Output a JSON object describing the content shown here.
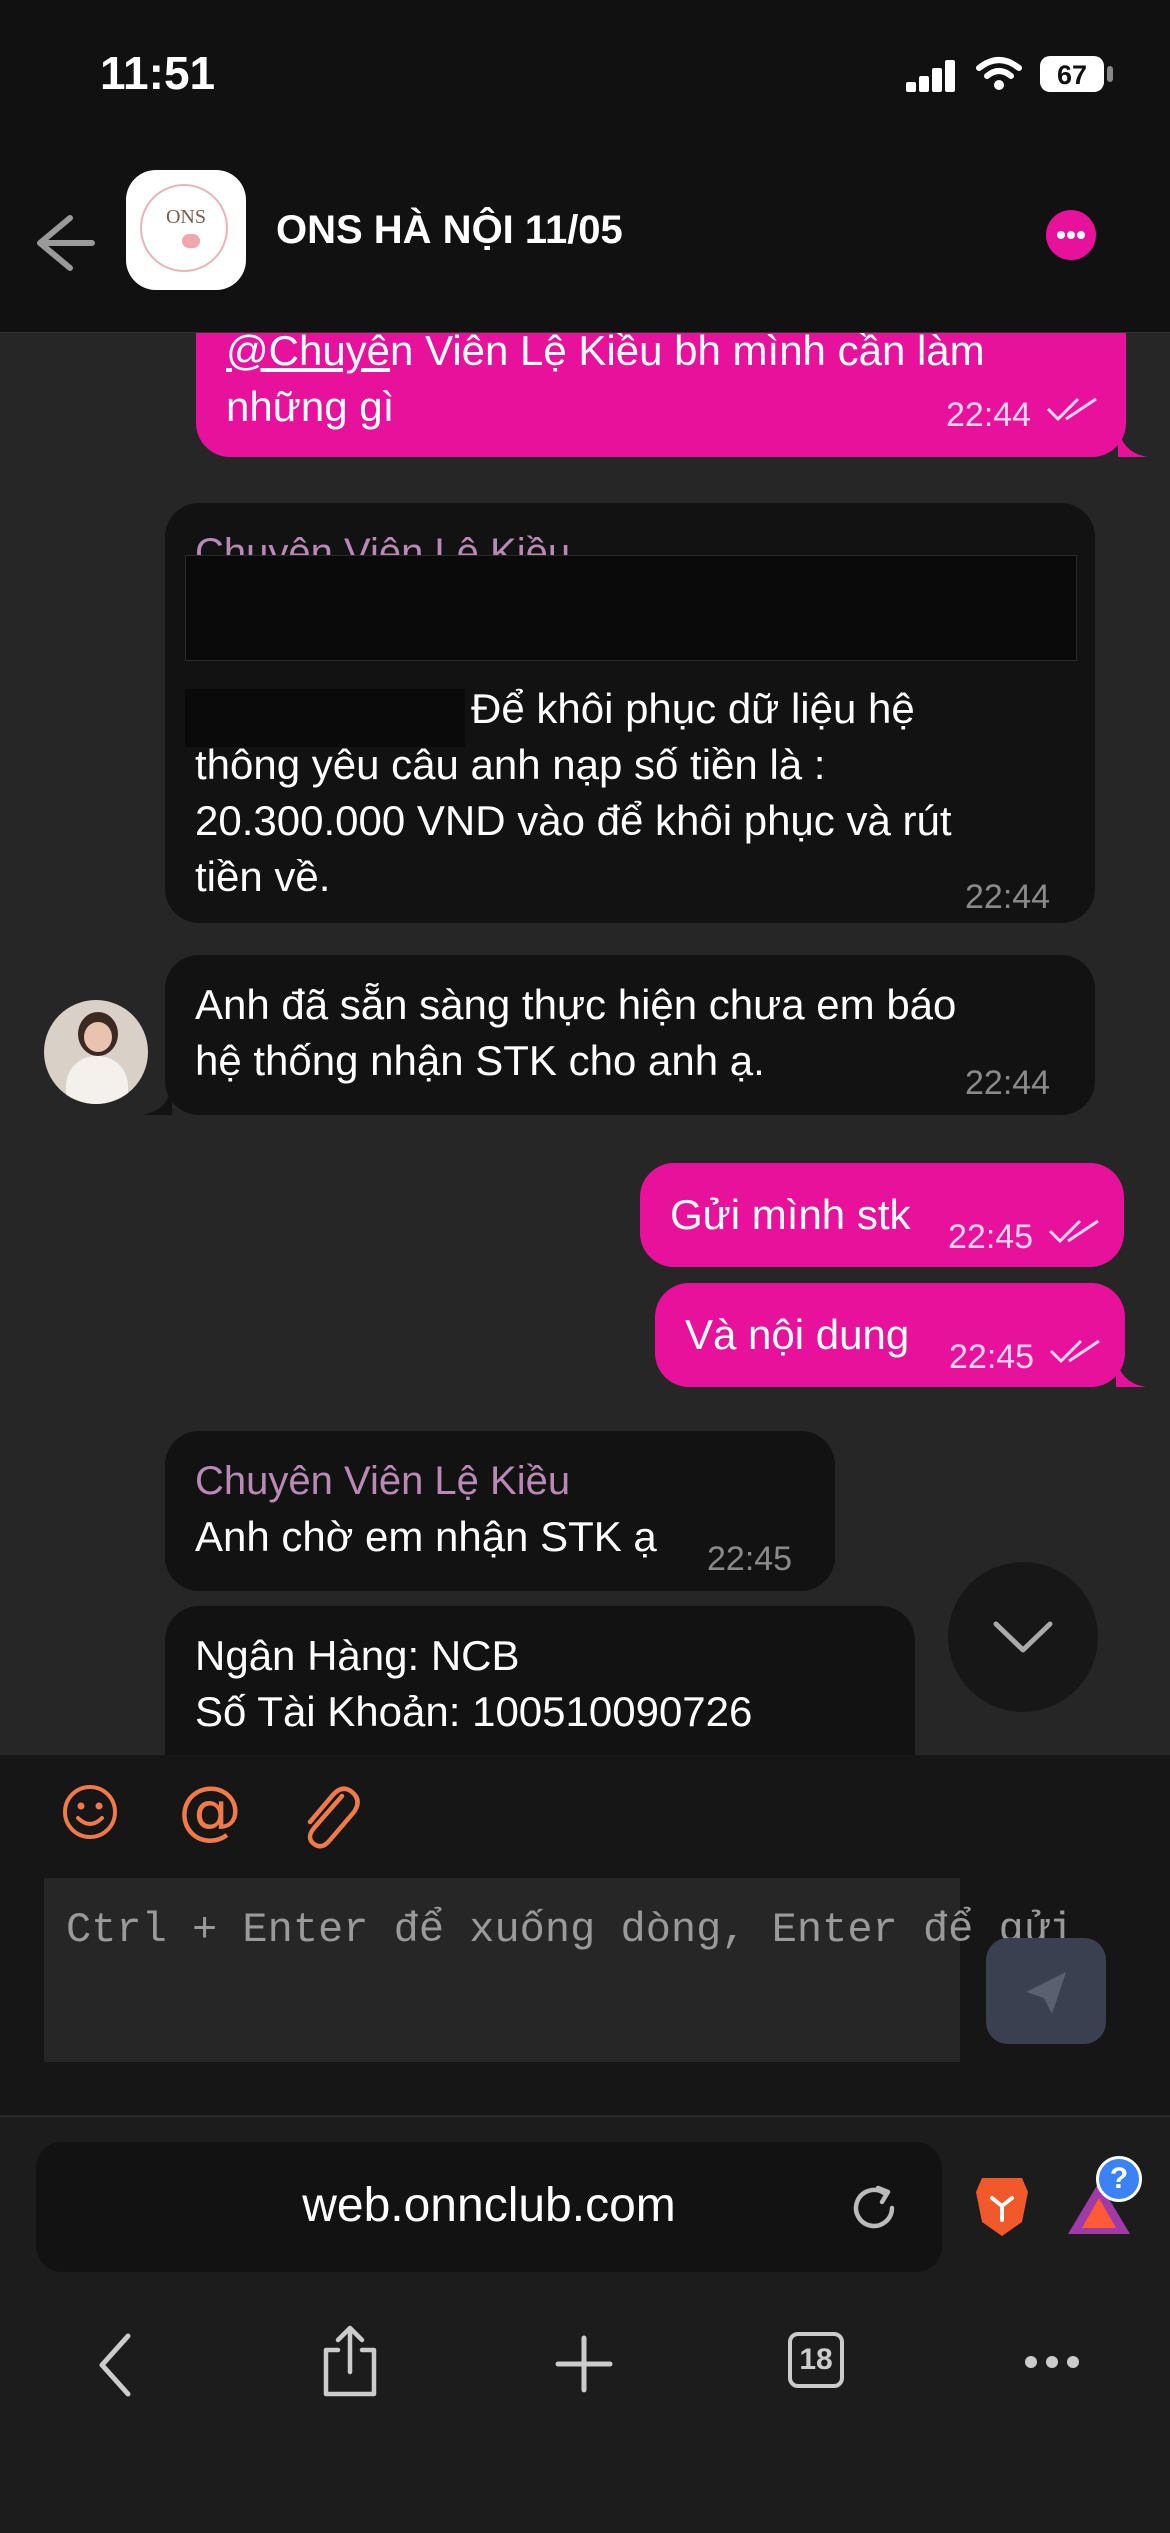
{
  "status_bar": {
    "time": "11:51",
    "battery": "67"
  },
  "header": {
    "title": "ONS HÀ NỘI 11/05",
    "avatar_text": "ONS"
  },
  "messages": [
    {
      "mention": "@Chuyê",
      "text_rest": "n Viên Lệ Kiều bh mình cần làm",
      "text_line2": "những gì",
      "time": "22:44"
    },
    {
      "sender": "Chuyên Viên Lệ Kiều",
      "line1": "Để khôi phục dữ liệu hệ",
      "line2": "thông yêu câu anh nạp số tiền là :",
      "line3": "20.300.000 VND vào để khôi phục và rút",
      "line4": "tiền về.",
      "time": "22:44"
    },
    {
      "line1": "Anh đã sẵn sàng thực hiện chưa em báo",
      "line2": "hệ thống nhận STK cho anh ạ.",
      "time": "22:44"
    },
    {
      "text": "Gửi mình stk",
      "time": "22:45"
    },
    {
      "text": "Và nội dung",
      "time": "22:45"
    },
    {
      "sender": "Chuyên Viên Lệ Kiều",
      "text": "Anh chờ em nhận STK ạ",
      "time": "22:45"
    },
    {
      "line1": "Ngân Hàng: NCB",
      "line2": "Số Tài Khoản: 100510090726"
    }
  ],
  "composer": {
    "placeholder": "Ctrl + Enter để xuống dòng, Enter để gửi"
  },
  "browser": {
    "url": "web.onnclub.com",
    "tabs_count": "18",
    "badge": "?"
  },
  "colors": {
    "accent": "#e8119b",
    "incoming": "#121212",
    "background": "#262626",
    "sender": "#b98ab3",
    "icon_orange": "#f07a4a"
  }
}
